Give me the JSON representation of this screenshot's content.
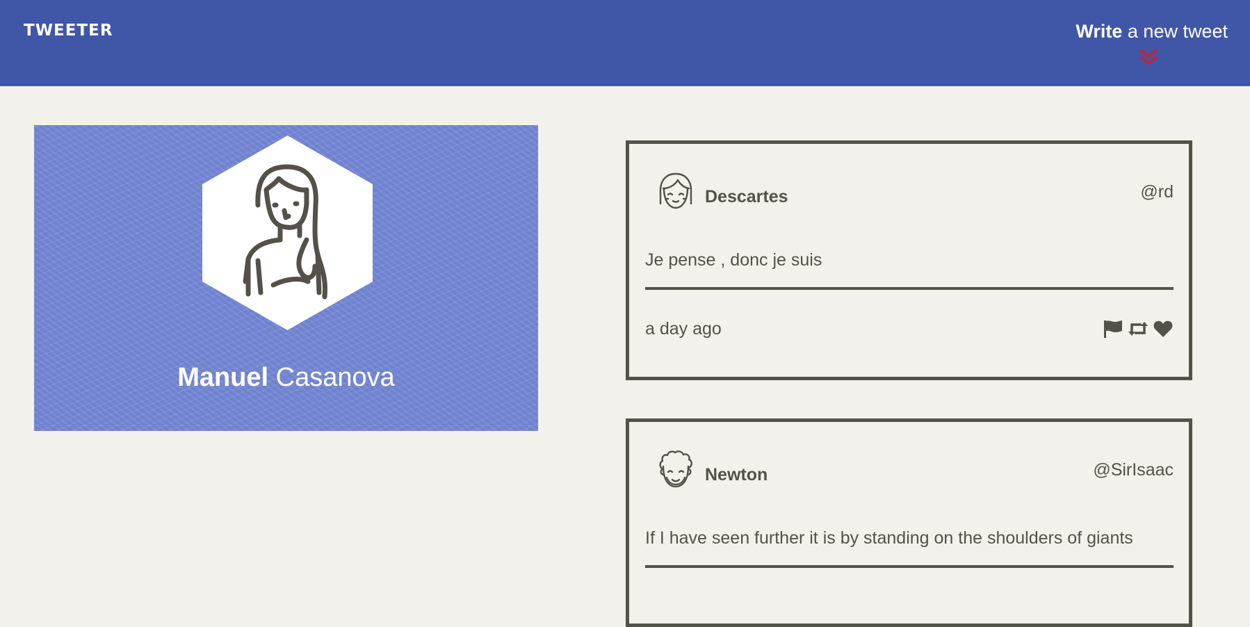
{
  "nav": {
    "brand": "TWEETER",
    "compose_strong": "Write",
    "compose_light": "a new tweet",
    "chevron_icon": "double-chevron-down-icon",
    "chevron_color": "#c0243a",
    "background": "#4056a6"
  },
  "profile": {
    "first_name": "Manuel",
    "last_name": "Casanova",
    "avatar_icon": "woman-avatar-icon",
    "background": "#7487d6"
  },
  "tweets": [
    {
      "author": "Descartes",
      "handle": "@rd",
      "body": "Je pense , donc je suis",
      "time": "a day ago",
      "avatar_icon": "girl-avatar-icon",
      "actions": [
        "flag-icon",
        "retweet-icon",
        "heart-icon"
      ]
    },
    {
      "author": "Newton",
      "handle": "@SirIsaac",
      "body": "If I have seen further it is by standing on the shoulders of giants",
      "avatar_icon": "curly-hair-avatar-icon"
    }
  ]
}
